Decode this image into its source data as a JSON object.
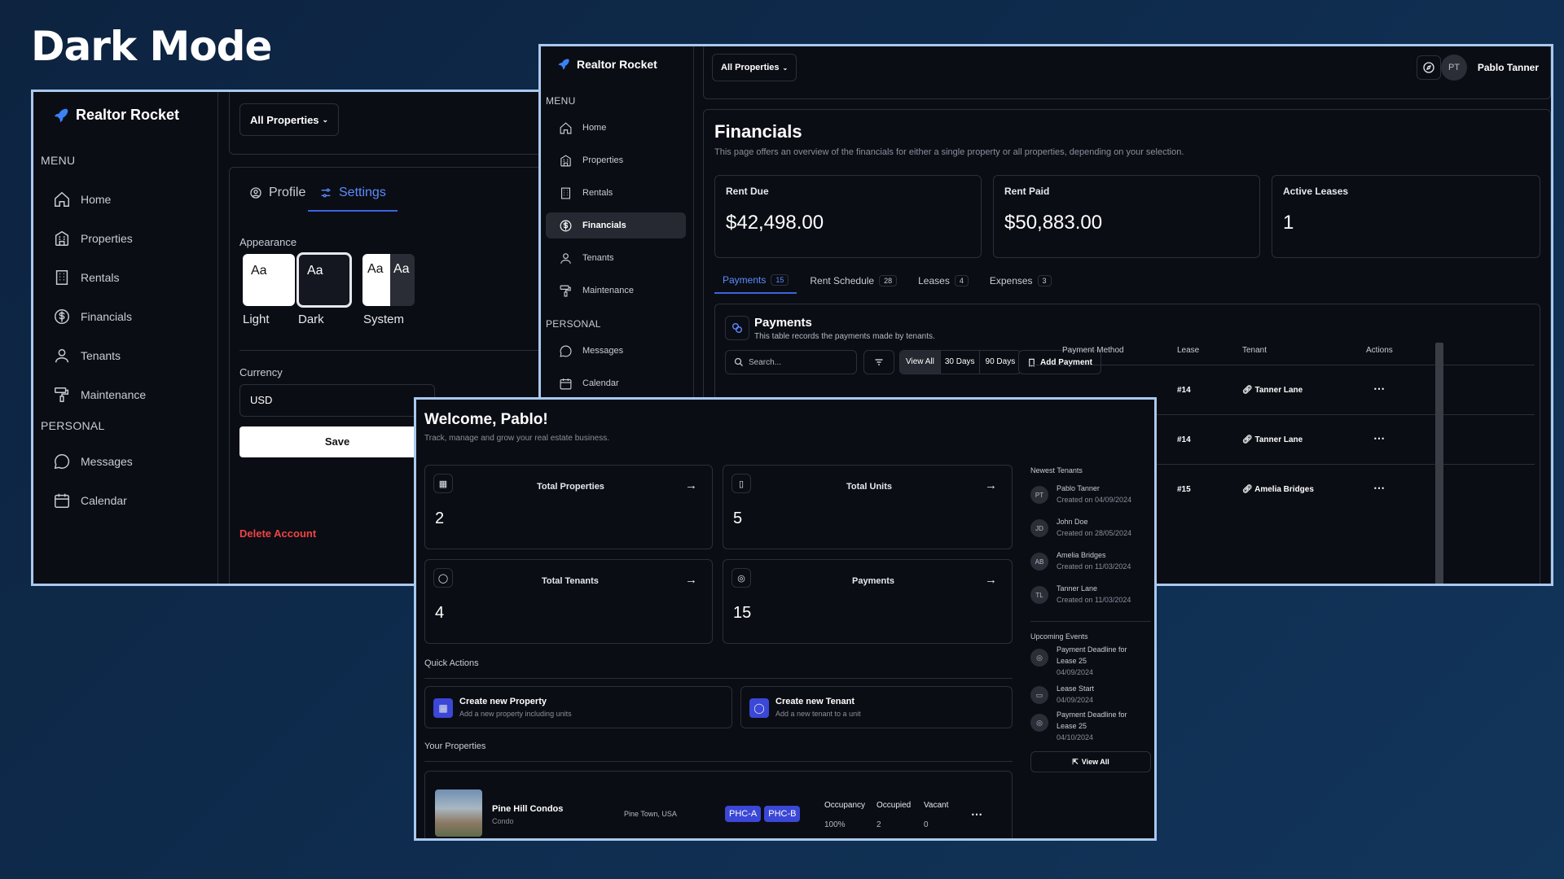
{
  "page_title": "Dark Mode",
  "brand": "Realtor Rocket",
  "menu_label": "MENU",
  "personal_label": "PERSONAL",
  "menu": [
    "Home",
    "Properties",
    "Rentals",
    "Financials",
    "Tenants",
    "Maintenance"
  ],
  "personal": [
    "Messages",
    "Calendar"
  ],
  "property_filter": "All Properties",
  "settings": {
    "tabs": [
      "Profile",
      "Settings"
    ],
    "appearance_label": "Appearance",
    "themes": [
      {
        "sample": "Aa",
        "label": "Light"
      },
      {
        "sample": "Aa",
        "label": "Dark"
      },
      {
        "sample": "Aa",
        "label": "System"
      }
    ],
    "currency_label": "Currency",
    "currency_value": "USD",
    "save": "Save",
    "delete": "Delete Account"
  },
  "financials": {
    "user_initials": "PT",
    "user_name": "Pablo Tanner",
    "title": "Financials",
    "desc": "This page offers an overview of the financials for either a single property or all properties, depending on your selection.",
    "stats": [
      {
        "label": "Rent Due",
        "value": "$42,498.00"
      },
      {
        "label": "Rent Paid",
        "value": "$50,883.00"
      },
      {
        "label": "Active Leases",
        "value": "1"
      }
    ],
    "tabs": [
      {
        "label": "Payments",
        "count": "15"
      },
      {
        "label": "Rent Schedule",
        "count": "28"
      },
      {
        "label": "Leases",
        "count": "4"
      },
      {
        "label": "Expenses",
        "count": "3"
      }
    ],
    "section_title": "Payments",
    "section_desc": "This table records the payments made by tenants.",
    "search_placeholder": "Search...",
    "ranges": [
      "View All",
      "30 Days",
      "90 Days"
    ],
    "add_payment": "Add Payment",
    "columns": [
      "Payment Method",
      "Lease",
      "Tenant",
      "Actions"
    ],
    "rows": [
      {
        "lease": "#14",
        "tenant": "Tanner Lane"
      },
      {
        "lease": "#14",
        "tenant": "Tanner Lane"
      },
      {
        "lease": "#15",
        "tenant": "Amelia Bridges"
      }
    ]
  },
  "dashboard": {
    "welcome": "Welcome, Pablo!",
    "subtitle": "Track, manage and grow your real estate business.",
    "cards": [
      {
        "label": "Total Properties",
        "value": "2"
      },
      {
        "label": "Total Units",
        "value": "5"
      },
      {
        "label": "Total Tenants",
        "value": "4"
      },
      {
        "label": "Payments",
        "value": "15"
      }
    ],
    "quick_actions_label": "Quick Actions",
    "quick_actions": [
      {
        "title": "Create new Property",
        "desc": "Add a new property including units"
      },
      {
        "title": "Create new Tenant",
        "desc": "Add a new tenant to a unit"
      }
    ],
    "your_properties_label": "Your Properties",
    "property": {
      "name": "Pine Hill Condos",
      "type": "Condo",
      "location": "Pine Town, USA",
      "tags": [
        "PHC-A",
        "PHC-B"
      ],
      "occupancy_label": "Occupancy",
      "occupied_label": "Occupied",
      "vacant_label": "Vacant",
      "occupancy": "100%",
      "occupied": "2",
      "vacant": "0"
    },
    "newest_tenants_label": "Newest Tenants",
    "tenants": [
      {
        "initials": "PT",
        "name": "Pablo Tanner",
        "created": "Created on 04/09/2024"
      },
      {
        "initials": "JD",
        "name": "John Doe",
        "created": "Created on 28/05/2024"
      },
      {
        "initials": "AB",
        "name": "Amelia Bridges",
        "created": "Created on 11/03/2024"
      },
      {
        "initials": "TL",
        "name": "Tanner Lane",
        "created": "Created on 11/03/2024"
      }
    ],
    "upcoming_label": "Upcoming Events",
    "events": [
      {
        "l1": "Payment Deadline for",
        "l2": "Lease 25",
        "date": "04/09/2024"
      },
      {
        "l1": "Lease Start",
        "l2": "",
        "date": "04/09/2024"
      },
      {
        "l1": "Payment Deadline for",
        "l2": "Lease 25",
        "date": "04/10/2024"
      }
    ],
    "view_all": "View All"
  }
}
